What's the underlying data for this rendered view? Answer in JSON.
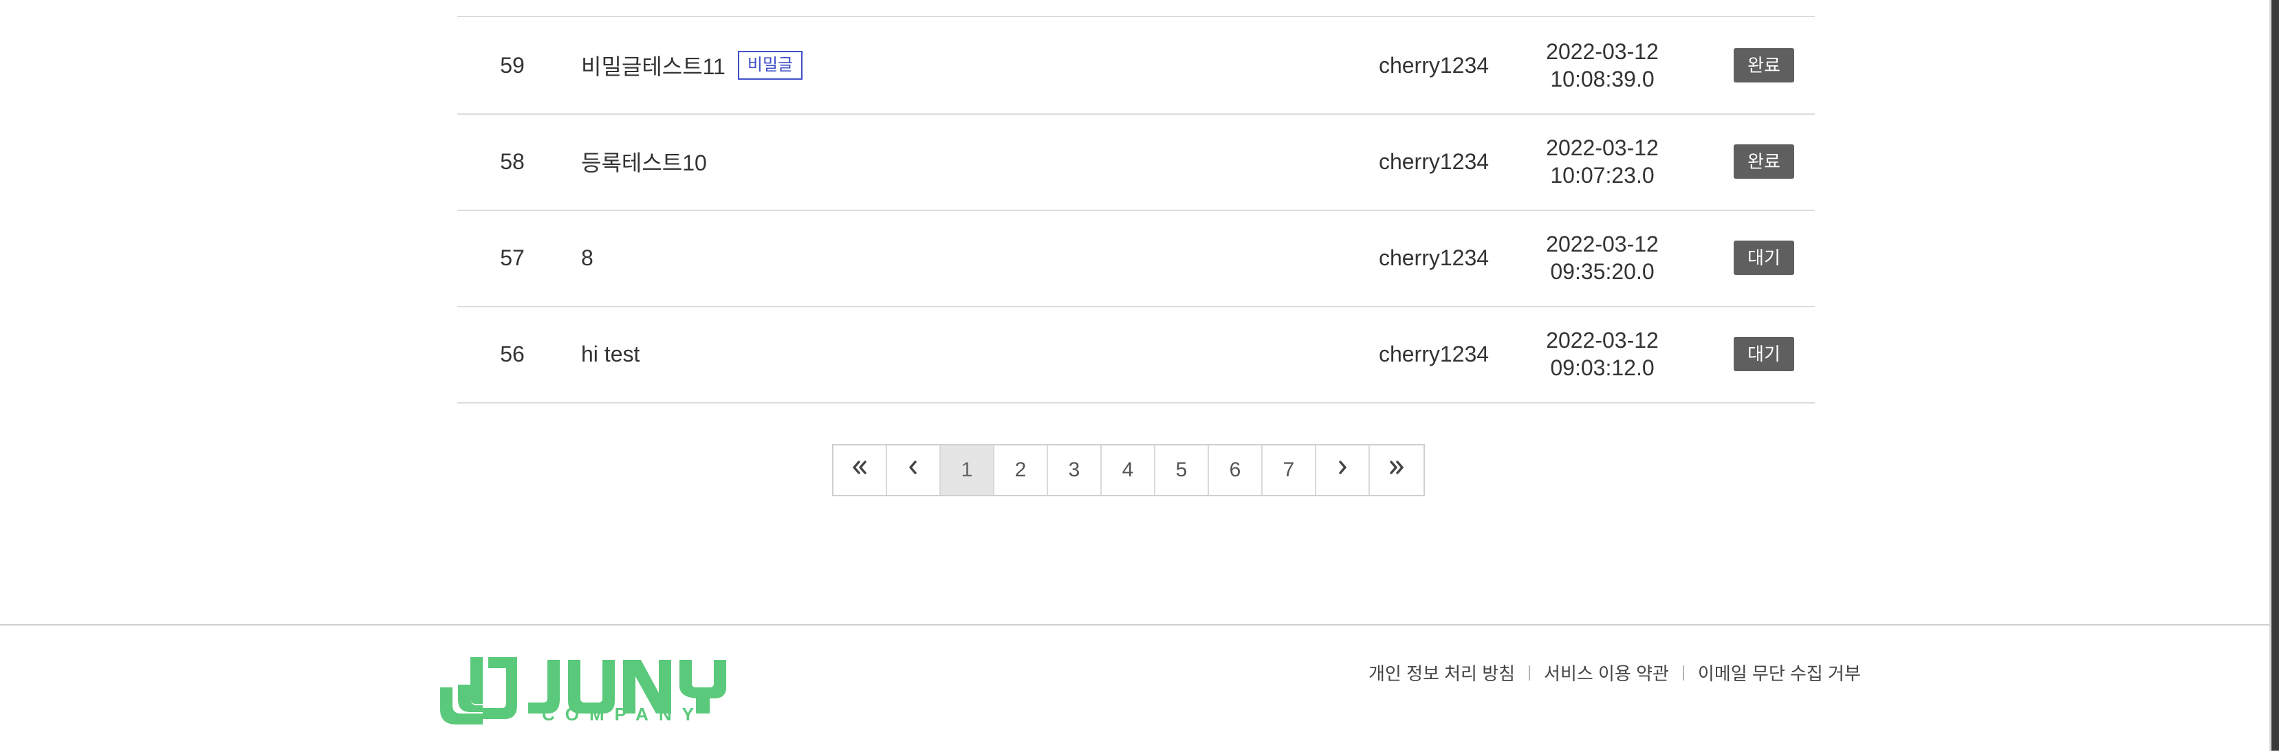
{
  "rows": [
    {
      "num": "59",
      "title": "비밀글테스트11",
      "badge": "비밀글",
      "user": "cherry1234",
      "date": "2022-03-12",
      "time": "10:08:39.0",
      "status": "완료"
    },
    {
      "num": "58",
      "title": "등록테스트10",
      "badge": "",
      "user": "cherry1234",
      "date": "2022-03-12",
      "time": "10:07:23.0",
      "status": "완료"
    },
    {
      "num": "57",
      "title": "8",
      "badge": "",
      "user": "cherry1234",
      "date": "2022-03-12",
      "time": "09:35:20.0",
      "status": "대기"
    },
    {
      "num": "56",
      "title": "hi test",
      "badge": "",
      "user": "cherry1234",
      "date": "2022-03-12",
      "time": "09:03:12.0",
      "status": "대기"
    }
  ],
  "pagination": {
    "pages": [
      "1",
      "2",
      "3",
      "4",
      "5",
      "6",
      "7"
    ],
    "current": "1",
    "first_icon": "double-chevron-left-icon",
    "prev_icon": "chevron-left-icon",
    "next_icon": "chevron-right-icon",
    "last_icon": "double-chevron-right-icon"
  },
  "footer": {
    "logo_text": "JUNY",
    "logo_subtext": "COMPANY",
    "links": [
      "개인 정보 처리 방침",
      "서비스 이용 약관",
      "이메일 무단 수집 거부"
    ],
    "brand_color": "#5bc97b"
  },
  "colors": {
    "status_button": "#5f5f5f",
    "secret_badge": "#3f50c8",
    "active_page_bg": "#e5e5e5"
  }
}
